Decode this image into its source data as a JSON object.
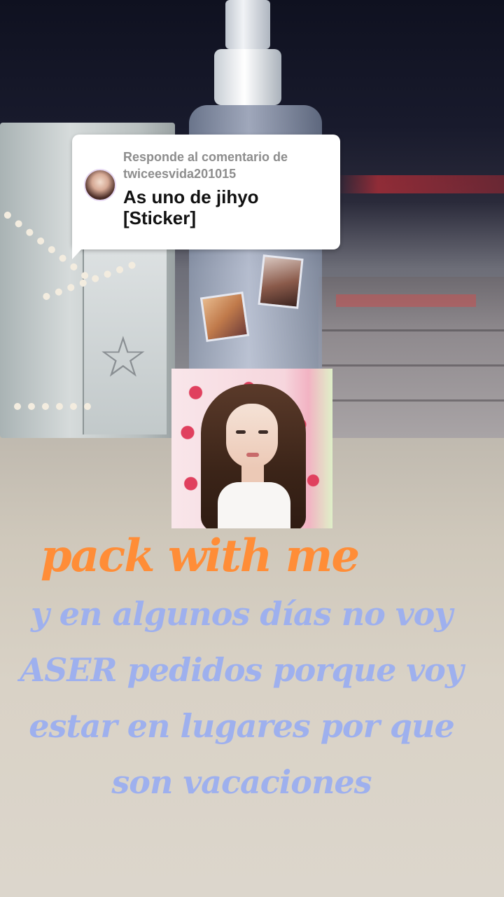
{
  "reply": {
    "header_line1": "Responde al comentario de",
    "header_line2": "twiceesvida201015",
    "body_line1": "As uno de jihyo",
    "body_line2": "[Sticker]"
  },
  "captions": {
    "title": "pack with me",
    "lines": [
      "y en algunos días no voy",
      "ASER pedidos porque voy",
      "estar en lugares por que",
      "son vacaciones"
    ]
  },
  "colors": {
    "title_orange": "#ff8d37",
    "caption_blue": "#9eb0ee",
    "reply_bg": "#ffffff",
    "reply_header_gray": "#8d8d8d"
  }
}
